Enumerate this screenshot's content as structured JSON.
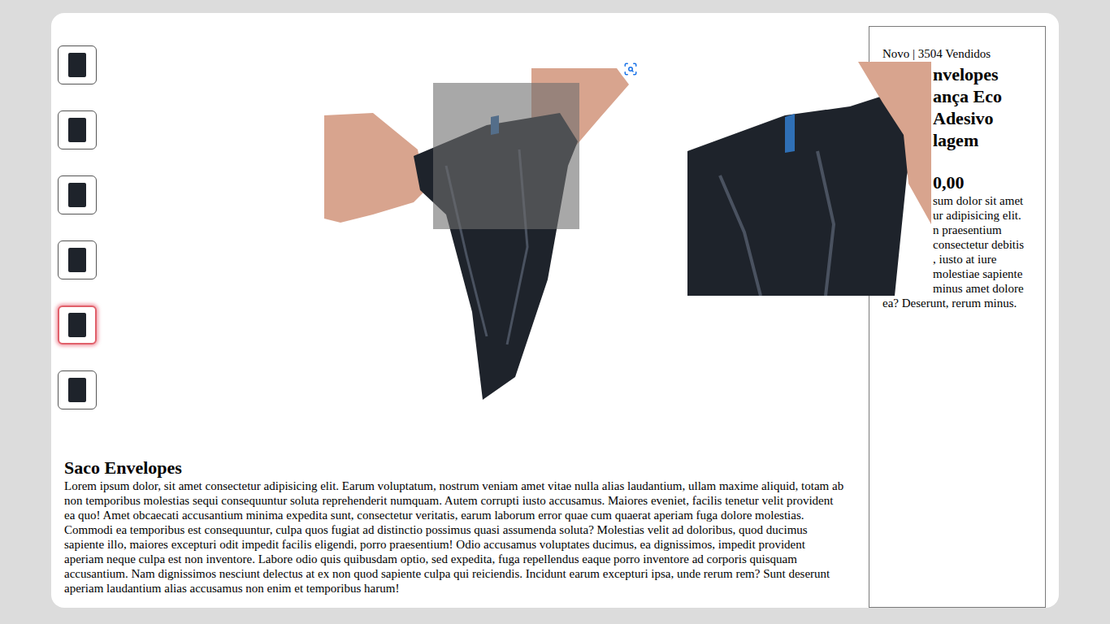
{
  "gallery": {
    "thumbnails": [
      {
        "selected": false
      },
      {
        "selected": false
      },
      {
        "selected": false
      },
      {
        "selected": false
      },
      {
        "selected": true
      },
      {
        "selected": false
      }
    ]
  },
  "product": {
    "heading": "Saco Envelopes",
    "description": "Lorem ipsum dolor, sit amet consectetur adipisicing elit. Earum voluptatum, nostrum veniam amet vitae nulla alias laudantium, ullam maxime aliquid, totam ab non temporibus molestias sequi consequuntur soluta reprehenderit numquam. Autem corrupti iusto accusamus. Maiores eveniet, facilis tenetur velit provident ea quo! Amet obcaecati accusantium minima expedita sunt, consectetur veritatis, earum laborum error quae cum quaerat aperiam fuga dolore molestias. Commodi ea temporibus est consequuntur, culpa quos fugiat ad distinctio possimus quasi assumenda soluta? Molestias velit ad doloribus, quod ducimus sapiente illo, maiores excepturi odit impedit facilis eligendi, porro praesentium! Odio accusamus voluptates ducimus, ea dignissimos, impedit provident aperiam neque culpa est non inventore. Labore odio quis quibusdam optio, sed expedita, fuga repellendus eaque porro inventore ad corporis quisquam accusantium. Nam dignissimos nesciunt delectus at ex non quod sapiente culpa qui reiciendis. Incidunt earum excepturi ipsa, unde rerum rem? Sunt deserunt aperiam laudantium alias accusamus non enim et temporibus harum!"
  },
  "info": {
    "stats": "Novo | 3504 Vendidos",
    "title_lines": [
      {
        "text": "nvelopes",
        "covered": true
      },
      {
        "text": "ança Eco",
        "covered": true
      },
      {
        "text": "Adesivo",
        "covered": true
      },
      {
        "text": "lagem",
        "covered": true
      }
    ],
    "price": {
      "text": "0,00",
      "covered": true
    },
    "description_lines": [
      {
        "text": "sum dolor sit amet",
        "covered": true
      },
      {
        "text": "ur adipisicing elit.",
        "covered": true
      },
      {
        "text": "n praesentium",
        "covered": true
      },
      {
        "text": "consectetur debitis",
        "covered": true
      },
      {
        "text": ", iusto at iure",
        "covered": true
      },
      {
        "text": "molestiae sapiente",
        "covered": true
      },
      {
        "text": "minus amet dolore",
        "covered": true
      },
      {
        "text": "ea? Deserunt, rerum minus.",
        "covered": false
      }
    ]
  }
}
